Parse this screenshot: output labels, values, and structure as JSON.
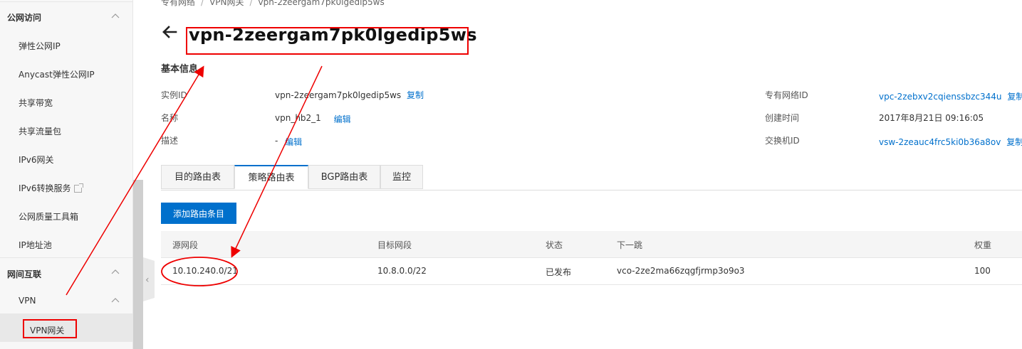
{
  "sidebar": {
    "groups": [
      {
        "title": "公网访问",
        "items": [
          "弹性公网IP",
          "Anycast弹性公网IP",
          "共享带宽",
          "共享流量包",
          "IPv6网关",
          "IPv6转换服务",
          "公网质量工具箱",
          "IP地址池"
        ]
      },
      {
        "title": "网间互联"
      }
    ],
    "vpn_label": "VPN",
    "active_item": "VPN网关"
  },
  "breadcrumb": [
    "专有网络",
    "VPN网关",
    "vpn-2zeergam7pk0lgedip5ws"
  ],
  "header": {
    "title": "vpn-2zeergam7pk0lgedip5ws"
  },
  "basic_info": {
    "section_title": "基本信息",
    "instance_id_label": "实例ID",
    "instance_id": "vpn-2zeergam7pk0lgedip5ws",
    "copy_label": "复制",
    "name_label": "名称",
    "name": "vpn_hb2_1",
    "edit_label": "编辑",
    "desc_label": "描述",
    "desc": "-",
    "vpc_id_label": "专有网络ID",
    "vpc_id": "vpc-2zebxv2cqienssbzc344u",
    "created_label": "创建时间",
    "created": "2017年8月21日 09:16:05",
    "vswitch_label": "交换机ID",
    "vswitch_id": "vsw-2zeauc4frc5ki0b36a8ov"
  },
  "tabs": [
    "目的路由表",
    "策略路由表",
    "BGP路由表",
    "监控"
  ],
  "active_tab": "策略路由表",
  "add_button": "添加路由条目",
  "table": {
    "headers": [
      "源网段",
      "目标网段",
      "状态",
      "下一跳",
      "权重"
    ],
    "rows": [
      [
        "10.10.240.0/21",
        "10.8.0.0/22",
        "已发布",
        "vco-2ze2ma66zqgfjrmp3o9o3",
        "100"
      ]
    ]
  },
  "colors": {
    "accent": "#0070cc",
    "annotation": "#e00000"
  }
}
